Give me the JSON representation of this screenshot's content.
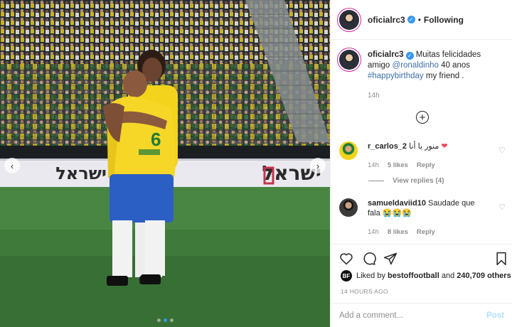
{
  "post": {
    "author": "oficialrc3",
    "follow_state": "Following",
    "separator": "•",
    "verified_icon": "verified-badge-icon"
  },
  "caption": {
    "author": "oficialrc3",
    "text_before": "Muitas felicidades amigo",
    "mention": "@ronaldinho",
    "text_middle": "40 anos",
    "hashtag": "#happybirthday",
    "text_after": "my friend .",
    "time": "14h"
  },
  "load_more_icon": "plus-circle-icon",
  "comments": [
    {
      "user": "r_carlos_2",
      "text": "منور يا أنا",
      "emoji": "❤",
      "time": "14h",
      "likes": "5 likes",
      "reply": "Reply",
      "view_replies": "View replies (4)"
    },
    {
      "user": "samueldaviid10",
      "text": "Saudade que fala 😭😭😭",
      "time": "14h",
      "likes": "8 likes",
      "reply": "Reply"
    }
  ],
  "likes": {
    "liked_by_label": "Liked by",
    "liked_by_user": "bestoffootball",
    "and_label": "and",
    "others": "240,709 others",
    "mini_avatar_text": "BF"
  },
  "timestamp": "14 HOURS AGO",
  "add_comment": {
    "placeholder": "Add a comment...",
    "post_label": "Post"
  },
  "media": {
    "banner_text": "ישראל",
    "jersey_number": "6",
    "carousel_total": 3,
    "carousel_active": 2
  },
  "colors": {
    "accent_blue": "#3897f0",
    "link_blue": "#3d6ea8",
    "muted_gray": "#8e8e8e",
    "heart_red": "#ed4956",
    "post_disabled": "#b2dffc"
  }
}
